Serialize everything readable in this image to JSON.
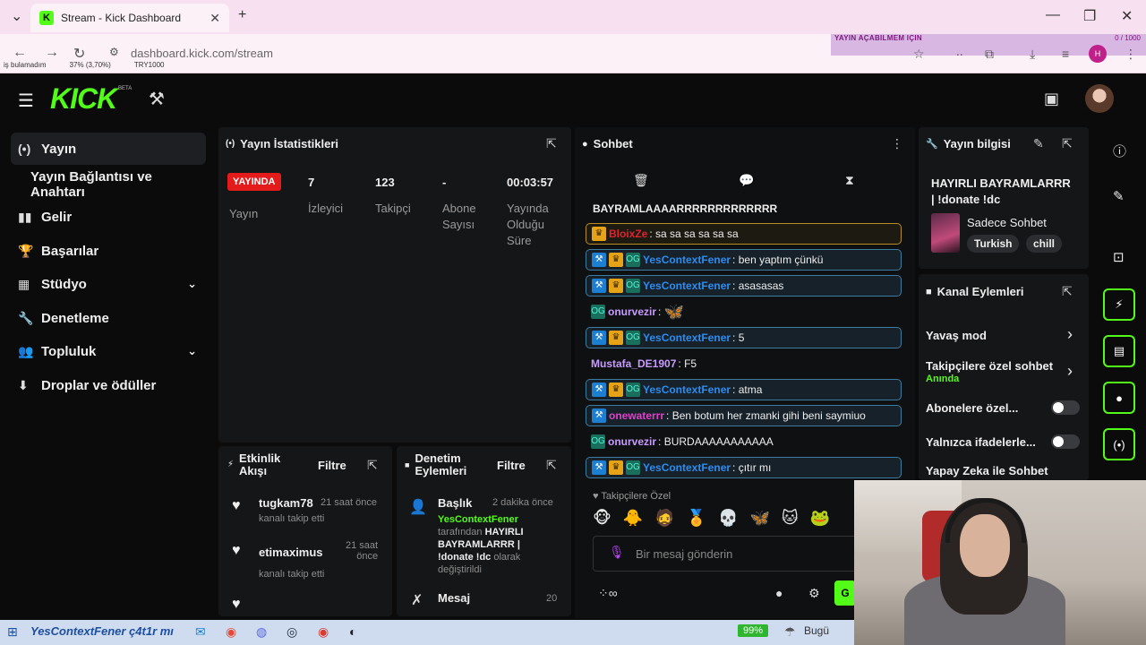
{
  "browser": {
    "tab_title": "Stream - Kick Dashboard",
    "tab_close": "✕",
    "new_tab": "+",
    "url": "dashboard.kick.com/stream",
    "ticker_left": "YAYIN AÇABILMEM IÇIN",
    "ticker_right": "0 / 1000",
    "bookmarks": [
      "iş bulamadım",
      "37% (3,70%)",
      "TRY1000"
    ]
  },
  "header": {
    "logo": "KICK",
    "beta": "BETA"
  },
  "sidebar": {
    "items": [
      {
        "label": "Yayın",
        "icon": "broadcast-icon",
        "glyph": "(•)"
      },
      {
        "label": "Yayın Bağlantısı ve Anahtarı"
      },
      {
        "label": "Gelir",
        "icon": "chart-icon",
        "glyph": "▮▮"
      },
      {
        "label": "Başarılar",
        "icon": "trophy-icon",
        "glyph": "🏆"
      },
      {
        "label": "Stüdyo",
        "icon": "studio-icon",
        "glyph": "▦"
      },
      {
        "label": "Denetleme",
        "icon": "wrench-icon",
        "glyph": "🔧"
      },
      {
        "label": "Topluluk",
        "icon": "community-icon",
        "glyph": "👥"
      },
      {
        "label": "Droplar ve ödüller",
        "icon": "drops-icon",
        "glyph": "⬇"
      }
    ]
  },
  "stats": {
    "title": "Yayın İstatistikleri",
    "live_badge": "YAYINDA",
    "status_label": "Yayın",
    "viewers": "7",
    "viewers_label": "İzleyici",
    "followers": "123",
    "followers_label": "Takipçi",
    "subs": "-",
    "subs_label_1": "Abone",
    "subs_label_2": "Sayısı",
    "uptime": "00:03:57",
    "uptime_label_1": "Yayında",
    "uptime_label_2": "Olduğu",
    "uptime_label_3": "Süre"
  },
  "activity": {
    "title_1": "Etkinlik",
    "title_2": "Akışı",
    "filter": "Filtre",
    "items": [
      {
        "name": "tugkam78",
        "time": "21 saat önce",
        "sub": "kanalı takip etti"
      },
      {
        "name": "etimaximus",
        "time_1": "21 saat",
        "time_2": "önce",
        "sub": "kanalı takip etti"
      }
    ]
  },
  "moderation": {
    "title_1": "Denetim",
    "title_2": "Eylemleri",
    "filter": "Filtre",
    "item_title": "Başlık",
    "item_time": "2 dakika önce",
    "item_user": "YesContextFener",
    "item_by": "tarafından",
    "item_value_1": "HAYIRLI",
    "item_value_2": "BAYRAMLARRR |",
    "item_value_3": "!donate !dc",
    "item_suffix": "olarak",
    "item_changed": "değiştirildi",
    "item2_title": "Mesaj",
    "item2_time": "20"
  },
  "chat": {
    "title": "Sohbet",
    "top_text": "BAYRAMLAAAARRRRRRRRRRRRR",
    "messages": [
      {
        "user": "BloixZe",
        "text": "sa sa sa sa sa sa",
        "color": "#e0232e"
      },
      {
        "user": "YesContextFener",
        "text": "ben yaptım çünkü",
        "color": "#2d8cf0"
      },
      {
        "user": "YesContextFener",
        "text": "asasasas",
        "color": "#2d8cf0"
      },
      {
        "user": "onurvezir",
        "text": "",
        "color": "#c79bff"
      },
      {
        "user": "YesContextFener",
        "text": "5",
        "color": "#2d8cf0"
      },
      {
        "user": "Mustafa_DE1907",
        "text": "F5",
        "color": "#c79bff"
      },
      {
        "user": "YesContextFener",
        "text": "atma",
        "color": "#2d8cf0"
      },
      {
        "user": "onewaterrr",
        "text": "Ben botum her zmanki gihi beni saymiuo",
        "color": "#e040c8"
      },
      {
        "user": "onurvezir",
        "text": "BURDAAAAAAAAAAA",
        "color": "#c79bff"
      },
      {
        "user": "YesContextFener",
        "text": "çıtır mı",
        "color": "#2d8cf0"
      }
    ],
    "followers_only": "Takipçilere Özel",
    "placeholder": "Bir mesaj gönderin",
    "send": "G"
  },
  "info": {
    "title": "Yayın bilgisi",
    "stream_title_1": "HAYIRLI BAYRAMLARRR",
    "stream_title_2": "| !donate !dc",
    "category": "Sadece Sohbet",
    "tags": [
      "Turkish",
      "chill"
    ]
  },
  "channel": {
    "title": "Kanal Eylemleri",
    "slow_mode": "Yavaş mod",
    "followers_chat": "Takipçilere özel sohbet",
    "followers_chat_sub": "Anında",
    "subs_only": "Abonelere özel...",
    "emotes_only": "Yalnızca ifadelerle...",
    "ai_chat": "Yapay Zeka ile Sohbet"
  },
  "taskbar": {
    "text": "YesContextFener ç4t1r mı",
    "battery": "99%",
    "weather": "Bugü"
  },
  "colors": {
    "accent": "#53fc18",
    "live": "#e31b1b",
    "panel": "#151618",
    "mod_blue": "#2d8cf0"
  }
}
